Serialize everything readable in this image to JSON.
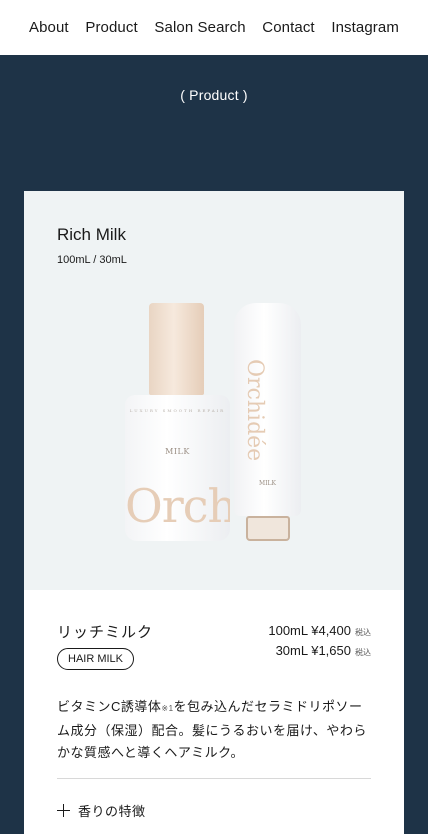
{
  "nav": {
    "items": [
      {
        "label": "About"
      },
      {
        "label": "Product"
      },
      {
        "label": "Salon Search"
      },
      {
        "label": "Contact"
      },
      {
        "label": "Instagram"
      }
    ]
  },
  "section": {
    "label": "( Product )"
  },
  "product": {
    "name_en": "Rich Milk",
    "sizes": "100mL / 30mL",
    "image": {
      "bottle_small_text": "LUXURY  SMOOTH  REPAIR",
      "bottle_type": "MILK",
      "bottle_brand": "Orchidée",
      "tube_brand": "Orchidée",
      "tube_type": "MILK"
    },
    "name_jp": "リッチミルク",
    "category_badge": "HAIR MILK",
    "prices": [
      {
        "text": "100mL ¥4,400",
        "tax": "税込"
      },
      {
        "text": "30mL ¥1,650",
        "tax": "税込"
      }
    ],
    "description": {
      "part1": "ビタミンC誘導体",
      "note": "※1",
      "part2": "を包み込んだセラミドリポソーム成分（保湿）配合。髪にうるおいを届け、やわらかな質感へと導くヘアミルク。"
    },
    "accordion_label": "香りの特徴"
  },
  "colors": {
    "background_navy": "#1e3347",
    "hero_bg": "#eff3f4",
    "accent_beige": "#e6cdb7"
  }
}
